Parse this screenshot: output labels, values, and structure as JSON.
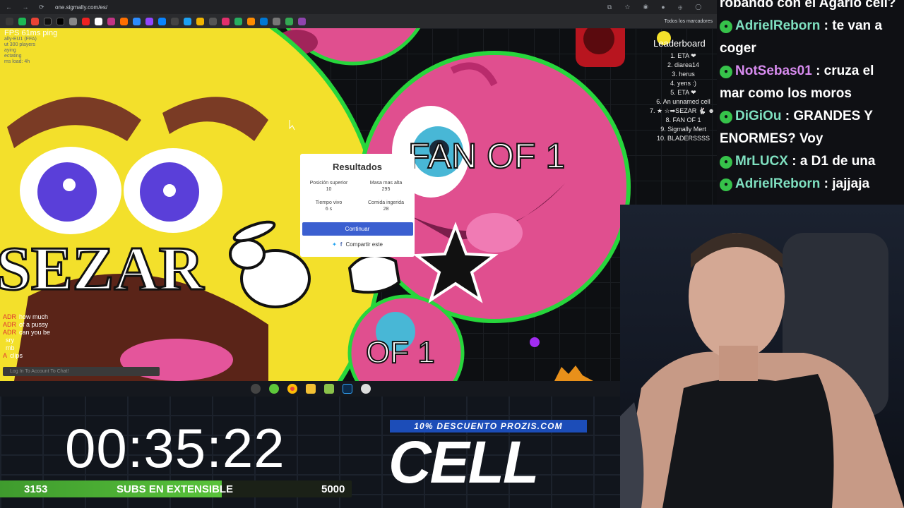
{
  "browser": {
    "url": "one.sigmally.com/es/",
    "bookmarks_all": "Todos los marcadores"
  },
  "game": {
    "fps_text": "FPS 61ms ping",
    "mode_lines": [
      "ally-EU1 (FFA)",
      "ut 300 players",
      "aying",
      "ectating",
      "ms load: 4h"
    ],
    "cells": {
      "big_cell_name": "SEZAR",
      "pink_cell_name": "FAN OF 1",
      "pink_cell_name_partial": "OF 1"
    },
    "leaderboard": {
      "title": "Leaderboard",
      "items": [
        "1. ETA ❤",
        "2. diarea14",
        "3. herus",
        "4. yens :)",
        "5. ETA ❤",
        "6. An unnamed cell",
        "7. ★ ☆➡SEZAR 🐇 ☻ ☺",
        "8. FAN OF 1",
        "9. Sigmally Mert",
        "10. BLADERSSSS"
      ]
    },
    "results": {
      "title": "Resultados",
      "stats": [
        {
          "label": "Posición superior",
          "value": "10"
        },
        {
          "label": "Masa mas alta",
          "value": "295"
        },
        {
          "label": "Tiempo vivo",
          "value": "6 s"
        },
        {
          "label": "Comida ingerida",
          "value": "28"
        }
      ],
      "continue_label": "Continuar",
      "share_label": "Compartir este"
    },
    "chat": [
      {
        "who": "ADR",
        "text": "how much"
      },
      {
        "who": "ADR",
        "text": "of a pussy"
      },
      {
        "who": "ADR",
        "text": "can you be"
      },
      {
        "who": "",
        "text": "sry"
      },
      {
        "who": "",
        "text": "mb"
      },
      {
        "who": "A",
        "text": "clips"
      }
    ],
    "chat_input_placeholder": "Log In To Account To Chat!"
  },
  "stream_chat": [
    {
      "user": "",
      "color": "#ffffff",
      "text": "robando con el Agario cell?"
    },
    {
      "user": "AdrielReborn",
      "color": "#7fe0c0",
      "text": ": te van a coger"
    },
    {
      "user": "NotSebas01",
      "color": "#d88cf0",
      "text": ": cruza el mar como los moros"
    },
    {
      "user": "DiGiOu",
      "color": "#7fe0c0",
      "text": ": GRANDES Y ENORMES? Voy"
    },
    {
      "user": "MrLUCX",
      "color": "#7fe0c0",
      "text": ": a D1 de una"
    },
    {
      "user": "AdrielReborn",
      "color": "#7fe0c0",
      "text": ": jajjaja"
    }
  ],
  "overlay": {
    "timer": "00:35:22",
    "subs_current": "3153",
    "subs_label": "SUBS EN EXTENSIBLE",
    "subs_goal": "5000",
    "subs_progress_fraction": 0.63,
    "promo": "10% DESCUENTO PROZIS.COM",
    "logo": "CELL"
  },
  "colors": {
    "accent_green": "#58c23a",
    "promo_blue": "#1c4db8",
    "continue_blue": "#3b5fd0",
    "yellow_cell": "#f3e02b",
    "pink_cell": "#e04f8f"
  }
}
